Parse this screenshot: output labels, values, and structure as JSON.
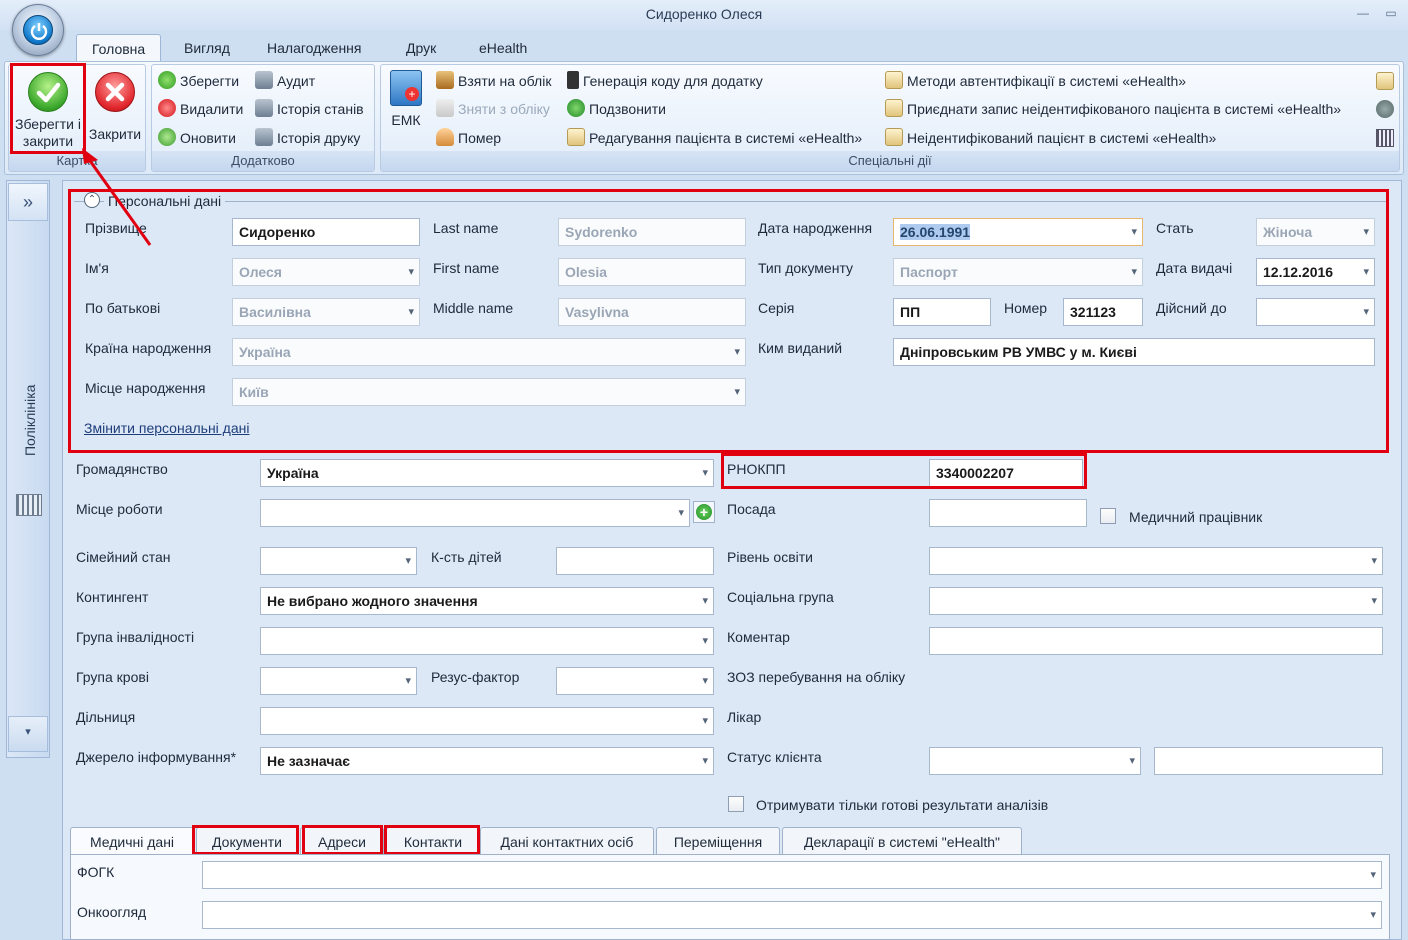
{
  "window": {
    "title": "Сидоренко Олеся"
  },
  "ribbon_tabs": [
    "Головна",
    "Вигляд",
    "Налагодження",
    "Друк",
    "eHealth"
  ],
  "ribbon": {
    "karta": {
      "label": "Картка",
      "save_close": "Зберегти і закрити",
      "close": "Закрити"
    },
    "dodatkovo": {
      "label": "Додатково",
      "save": "Зберегти",
      "delete": "Видалити",
      "refresh": "Оновити",
      "audit": "Аудит",
      "state_history": "Історія станів",
      "print_history": "Історія друку"
    },
    "special": {
      "label": "Спеціальні дії",
      "emk": "ЕМК",
      "take_register": "Взяти на облік",
      "remove_register": "Зняти з обліку",
      "died": "Помер",
      "gen_code": "Генерація коду для додатку",
      "call": "Подзвонити",
      "edit_patient": "Редагування пацієнта в системі «eHealth»",
      "auth_methods": "Методи автентифікації в системі «eHealth»",
      "attach_record": "Приєднати запис неідентифікованого пацієнта в системі «eHealth»",
      "unidentified": "Неідентифікований пацієнт в системі «eHealth»"
    }
  },
  "sidebar": {
    "label": "Поліклініка"
  },
  "personal": {
    "section_title": "Персональні дані",
    "surname_label": "Прізвище",
    "surname": "Сидоренко",
    "name_label": "Ім'я",
    "name": "Олеся",
    "patronymic_label": "По батькові",
    "patronymic": "Василівна",
    "lastname_label": "Last name",
    "lastname": "Sydorenko",
    "firstname_label": "First name",
    "firstname": "Olesia",
    "middlename_label": "Middle name",
    "middlename": "Vasylivna",
    "birth_country_label": "Країна народження",
    "birth_country": "Україна",
    "birth_place_label": "Місце народження",
    "birth_place": "Київ",
    "dob_label": "Дата народження",
    "dob": "26.06.1991",
    "doc_type_label": "Тип документу",
    "doc_type": "Паспорт",
    "series_label": "Серія",
    "series": "ПП",
    "number_label": "Номер",
    "number": "321123",
    "issued_by_label": "Ким виданий",
    "issued_by": "Дніпровським РВ УМВС  у м. Києві",
    "sex_label": "Стать",
    "sex": "Жіноча",
    "issue_date_label": "Дата видачі",
    "issue_date": "12.12.2016",
    "valid_to_label": "Дійсний до",
    "valid_to": "",
    "change_link": "Змінити персональні дані"
  },
  "form": {
    "citizenship_label": "Громадянство",
    "citizenship": "Україна",
    "rnokpp_label": "РНОКПП",
    "rnokpp": "3340002207",
    "work_label": "Місце роботи",
    "work": "",
    "position_label": "Посада",
    "position": "",
    "medical_worker_label": "Медичний працівник",
    "marital_label": "Сімейний стан",
    "children_label": "К-сть дітей",
    "education_label": "Рівень освіти",
    "contingent_label": "Контингент",
    "contingent": "Не вибрано жодного значення",
    "social_label": "Соціальна група",
    "disability_label": "Група інвалідності",
    "comment_label": "Коментар",
    "blood_label": "Група крові",
    "rh_label": "Резус-фактор",
    "zoz_label": "ЗОЗ перебування на обліку",
    "district_label": "Дільниця",
    "doctor_label": "Лікар",
    "source_label": "Джерело інформування*",
    "source": "Не зазначає",
    "client_status_label": "Статус клієнта",
    "ready_results_label": "Отримувати тільки готові результати аналізів"
  },
  "bottom_tabs": [
    "Медичні дані",
    "Документи",
    "Адреси",
    "Контакти",
    "Дані контактних осіб",
    "Переміщення",
    "Декларації в системі \"eHealth\""
  ],
  "medical": {
    "fogk_label": "ФОГК",
    "onko_label": "Онкоогляд"
  }
}
